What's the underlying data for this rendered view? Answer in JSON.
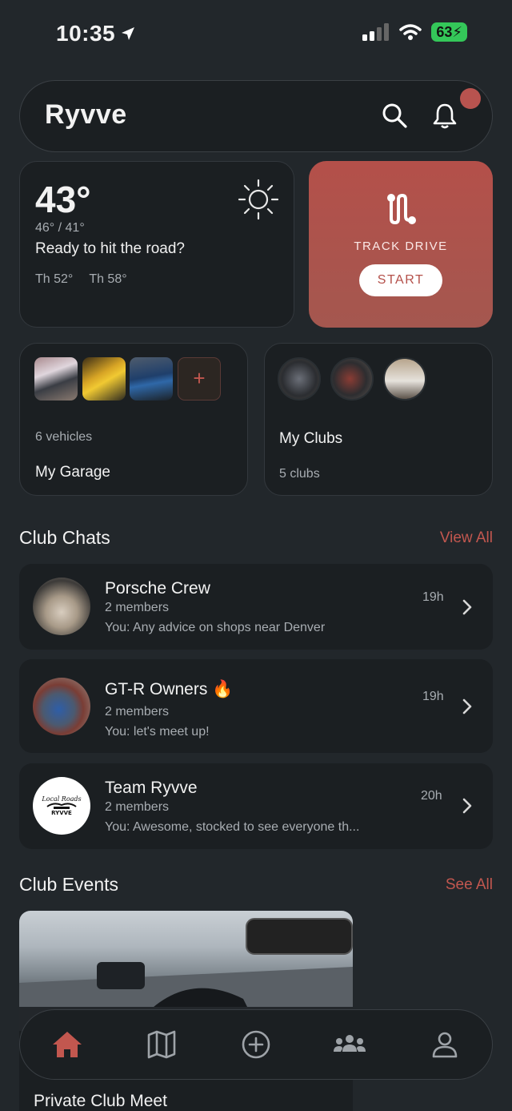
{
  "status": {
    "time": "10:35",
    "battery": "63"
  },
  "header": {
    "brand": "Ryvve"
  },
  "weather": {
    "temp": "43°",
    "hilo": "46° / 41°",
    "message": "Ready to hit the road?",
    "forecast": [
      "Th 52°",
      "Th 58°"
    ]
  },
  "track": {
    "label": "TRACK DRIVE",
    "button": "START"
  },
  "garage": {
    "count": "6 vehicles",
    "title": "My Garage"
  },
  "clubs": {
    "title": "My Clubs",
    "count": "5 clubs"
  },
  "club_chats": {
    "title": "Club Chats",
    "link": "View All",
    "items": [
      {
        "name": "Porsche Crew",
        "members": "2 members",
        "message": "You: Any advice on shops near Denver",
        "time": "19h"
      },
      {
        "name": "GT-R Owners 🔥",
        "members": "2 members",
        "message": "You: let's meet up!",
        "time": "19h"
      },
      {
        "name": "Team Ryvve",
        "members": "2 members",
        "message": "You: Awesome, stocked to see everyone th...",
        "time": "20h"
      }
    ]
  },
  "club_events": {
    "title": "Club Events",
    "link": "See All",
    "event_title": "Private Club Meet"
  },
  "logo_text": {
    "line1": "Local Roads",
    "line2": "RYVVE"
  },
  "colors": {
    "accent": "#c2574f",
    "card": "#1b1f22",
    "background": "#22272b",
    "track": "#b4504a"
  },
  "tabs": [
    "home-icon",
    "map-icon",
    "add-icon",
    "clubs-icon",
    "profile-icon"
  ]
}
